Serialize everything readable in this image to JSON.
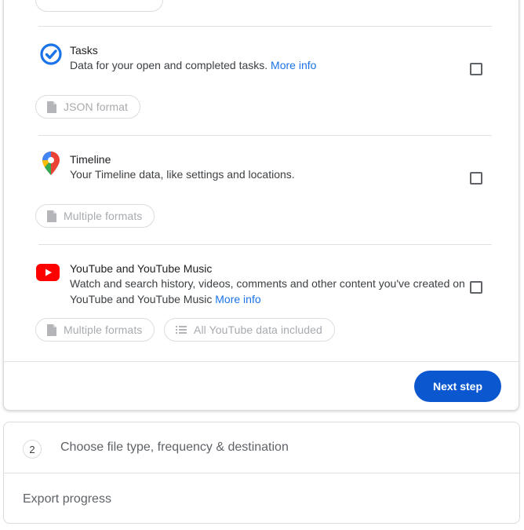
{
  "services": [
    {
      "title": "Tasks",
      "description": "Data for your open and completed tasks.",
      "link": "More info",
      "chips": [
        "JSON format"
      ],
      "icon": "google-tasks-icon"
    },
    {
      "title": "Timeline",
      "description": "Your Timeline data, like settings and locations.",
      "link": "",
      "chips": [
        "Multiple formats"
      ],
      "icon": "google-maps-pin-icon"
    },
    {
      "title": "YouTube and YouTube Music",
      "description": "Watch and search history, videos, comments and other content you've created on YouTube and YouTube Music",
      "link": "More info",
      "chips": [
        "Multiple formats",
        "All YouTube data included"
      ],
      "icon": "youtube-icon"
    }
  ],
  "next_button": "Next step",
  "step2": {
    "number": "2",
    "title": "Choose file type, frequency & destination"
  },
  "export_progress": "Export progress",
  "colors": {
    "accent": "#0b57d0",
    "link": "#1a73e8",
    "youtube_red": "#ff0000"
  }
}
